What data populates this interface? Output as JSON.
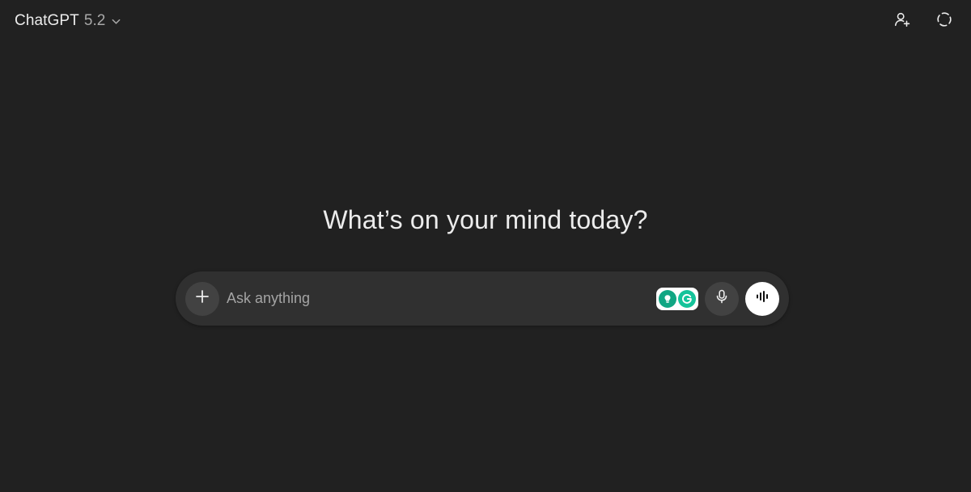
{
  "header": {
    "model_name": "ChatGPT",
    "model_version": "5.2",
    "icons": {
      "model_dropdown": "chevron-down-icon",
      "share": "add-person-icon",
      "temporary_chat": "dashed-circle-icon"
    }
  },
  "main": {
    "heading": "What’s on your mind today?"
  },
  "composer": {
    "placeholder": "Ask anything",
    "value": "",
    "icons": {
      "attach": "plus-icon",
      "extension_1": "lightbulb-icon",
      "extension_2": "grammarly-icon",
      "dictate": "microphone-icon",
      "voice_mode": "waveform-icon"
    }
  },
  "colors": {
    "background": "#212121",
    "composer": "#303030",
    "button": "#424242",
    "text": "#ececec",
    "muted_text": "#a4a4a4",
    "extension_green": "#11a683",
    "grammarly_green": "#15c39a",
    "voice_button": "#ffffff"
  }
}
